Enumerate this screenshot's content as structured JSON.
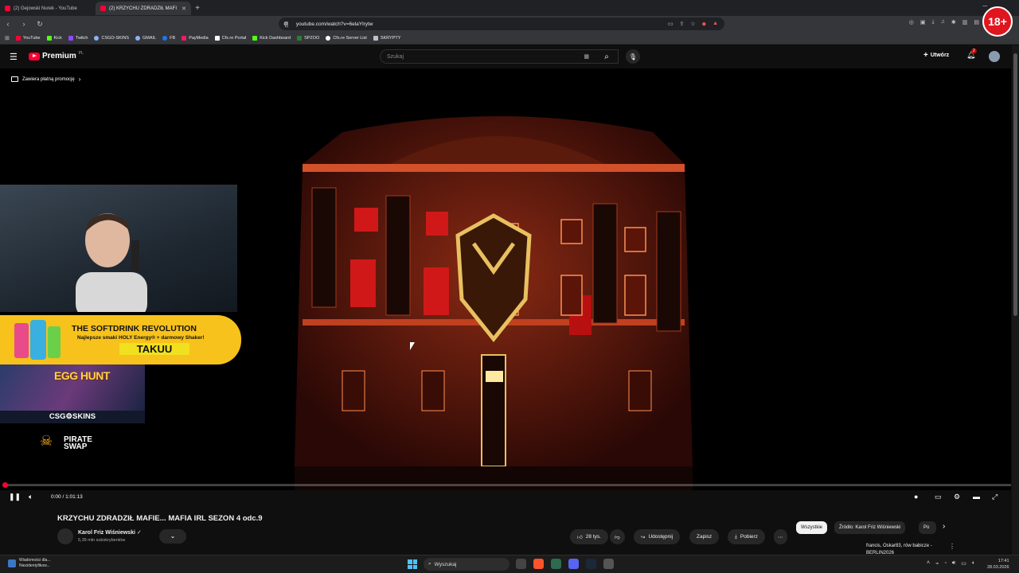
{
  "browser": {
    "tabs": [
      {
        "label": "(2) Gejowski Nurek - YouTube",
        "active": false
      },
      {
        "label": "(2) KRZYCHU ZDRADZIŁ MAFI",
        "active": true
      }
    ],
    "url": "youtube.com/watch?v=6elaYlrytw",
    "bookmarks": [
      {
        "label": "YouTube",
        "color": "#ff0033"
      },
      {
        "label": "Kick",
        "color": "#53fc18"
      },
      {
        "label": "Twitch",
        "color": "#9146ff"
      },
      {
        "label": "CSGO-SKINS",
        "color": "#8ab4f8"
      },
      {
        "label": "GMAIL",
        "color": "#8ab4f8"
      },
      {
        "label": "FB",
        "color": "#1877f2"
      },
      {
        "label": "PayMedia",
        "color": "#e91e63"
      },
      {
        "label": "Cfx.re Portal",
        "color": "#ffffff"
      },
      {
        "label": "Kick Dashboard",
        "color": "#53fc18"
      },
      {
        "label": "SPZOO",
        "color": "#2e7d32"
      },
      {
        "label": "Cfx.re Server List",
        "color": "#ffffff"
      },
      {
        "label": "SKRYPTY",
        "color": "#bdc1c6"
      }
    ],
    "age_badge": "18+"
  },
  "youtube": {
    "logo_text": "Premium",
    "logo_region": "PL",
    "search_placeholder": "Szukaj",
    "create_label": "Utwórz",
    "notification_count": "2"
  },
  "video": {
    "promo_label": "Zawiera płatną promocję",
    "time": "0:00 / 1:01:13",
    "progress": 0.0,
    "overlays": {
      "softdrink_title": "THE SOFTDRINK REVOLUTION",
      "softdrink_sub": "Najlepsze smaki HOLY Energy® + darmowy Shaker!",
      "softdrink_brand": "TAKUU",
      "egghunt_title": "EGG HUNT",
      "csgo_label": "CSG⚙SKINS",
      "pirate_label_1": "PIRATE",
      "pirate_label_2": "SWAP"
    }
  },
  "below": {
    "title": "KRZYCHU ZDRADZIŁ MAFIE... MAFIA IRL SEZON 4 odc.9",
    "channel": "Karol Friz Wiśniewski",
    "subs": "5,39 mln subskrybentów",
    "likes": "28 tys.",
    "share": "Udostępnij",
    "save": "Zapisz",
    "download": "Pobierz",
    "chips": [
      "Wszystkie",
      "Źródło: Karol Friz Wiśniewski",
      "Po"
    ],
    "rec_line1": "francis, Oskar83, rów babicze -",
    "rec_line2": "BERLIN2026"
  },
  "taskbar": {
    "news_line1": "Wiadomości dla...",
    "news_line2": "Niezidentyfikow...",
    "search": "Wyszukaj",
    "time": "17:41",
    "date": "28.03.2026"
  }
}
